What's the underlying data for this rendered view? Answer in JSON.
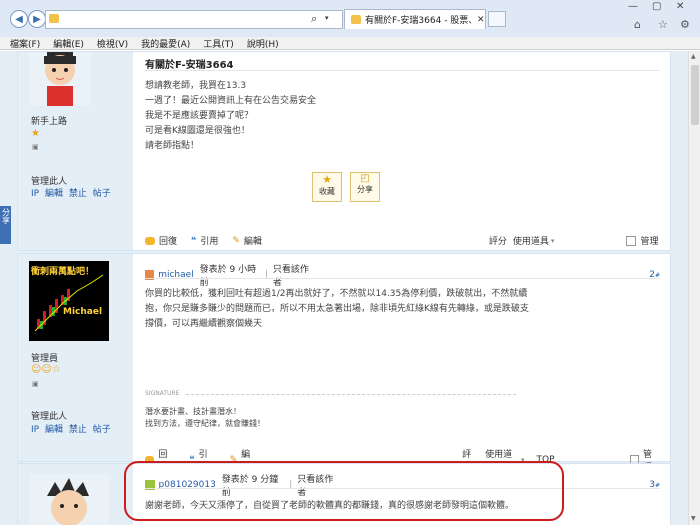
{
  "browser": {
    "tab_title": "有關於F-安瑞3664 - 股票、...",
    "menu": [
      "檔案(F)",
      "編輯(E)",
      "檢視(V)",
      "我的最愛(A)",
      "工具(T)",
      "說明(H)"
    ],
    "address": "",
    "search_glyph": "⌕",
    "win_minimize": "—",
    "win_maximize": "▢",
    "win_close": "✕"
  },
  "side_tab": "分享",
  "post1": {
    "title": "有關於F-安瑞3664",
    "user_rank": "新手上路",
    "manage_label": "管理此人",
    "manage_links": [
      "IP",
      "編輯",
      "禁止",
      "帖子"
    ],
    "lines": [
      "想請教老師，我買在13.3",
      "一週了！最近公開資訊上有在公告交易安全",
      "我是不是應該要賣掉了呢？",
      "可是看K線圖還是很強也！",
      "請老師指點！"
    ],
    "collect_label": "收藏",
    "share_label": "分享",
    "reply": "回復",
    "quote": "引用",
    "edit": "編輯",
    "rate": "評分",
    "tools": "使用道具",
    "admin": "管理"
  },
  "post2": {
    "author": "michael",
    "posted": "發表於 9 小時前",
    "only_author": "只看該作者",
    "floor": "2",
    "avatar_text_1": "衝刺兩萬點吧！",
    "avatar_text_2": "Michael",
    "user_rank": "管理員",
    "manage_label": "管理此人",
    "manage_links": [
      "IP",
      "編輯",
      "禁止",
      "帖子"
    ],
    "lines": [
      "你買的比較低，獲利回吐有超過1/2再出就好了，不然就以14.35為停利價，跌破就出，不然就續",
      "抱，你只是賺多賺少的問題而已，所以不用太急著出場，除非頃先紅綠K線有先轉綠，或是跌破支",
      "撐價，可以再繼續觀察個幾天"
    ],
    "signature_label": "SIGNATURE",
    "signature": [
      "潛水要計畫、技計畫潛水！",
      "找到方法，遵守紀律，就會賺錢！"
    ],
    "reply": "回復",
    "quote": "引用",
    "edit": "編輯",
    "rate": "評分",
    "tools": "使用道具",
    "top": "TOP",
    "admin": "管理"
  },
  "post3": {
    "author": "p081029013",
    "posted": "發表於 9 分鐘前",
    "only_author": "只看該作者",
    "floor": "3",
    "line": "謝謝老師，今天又漲停了，自從買了老師的軟體真的都賺錢，真的很感謝老師發明這個軟體。"
  },
  "colors": {
    "accent": "#245ba6",
    "highlight": "#cc1d1d",
    "page_bg": "#e4eef7"
  }
}
